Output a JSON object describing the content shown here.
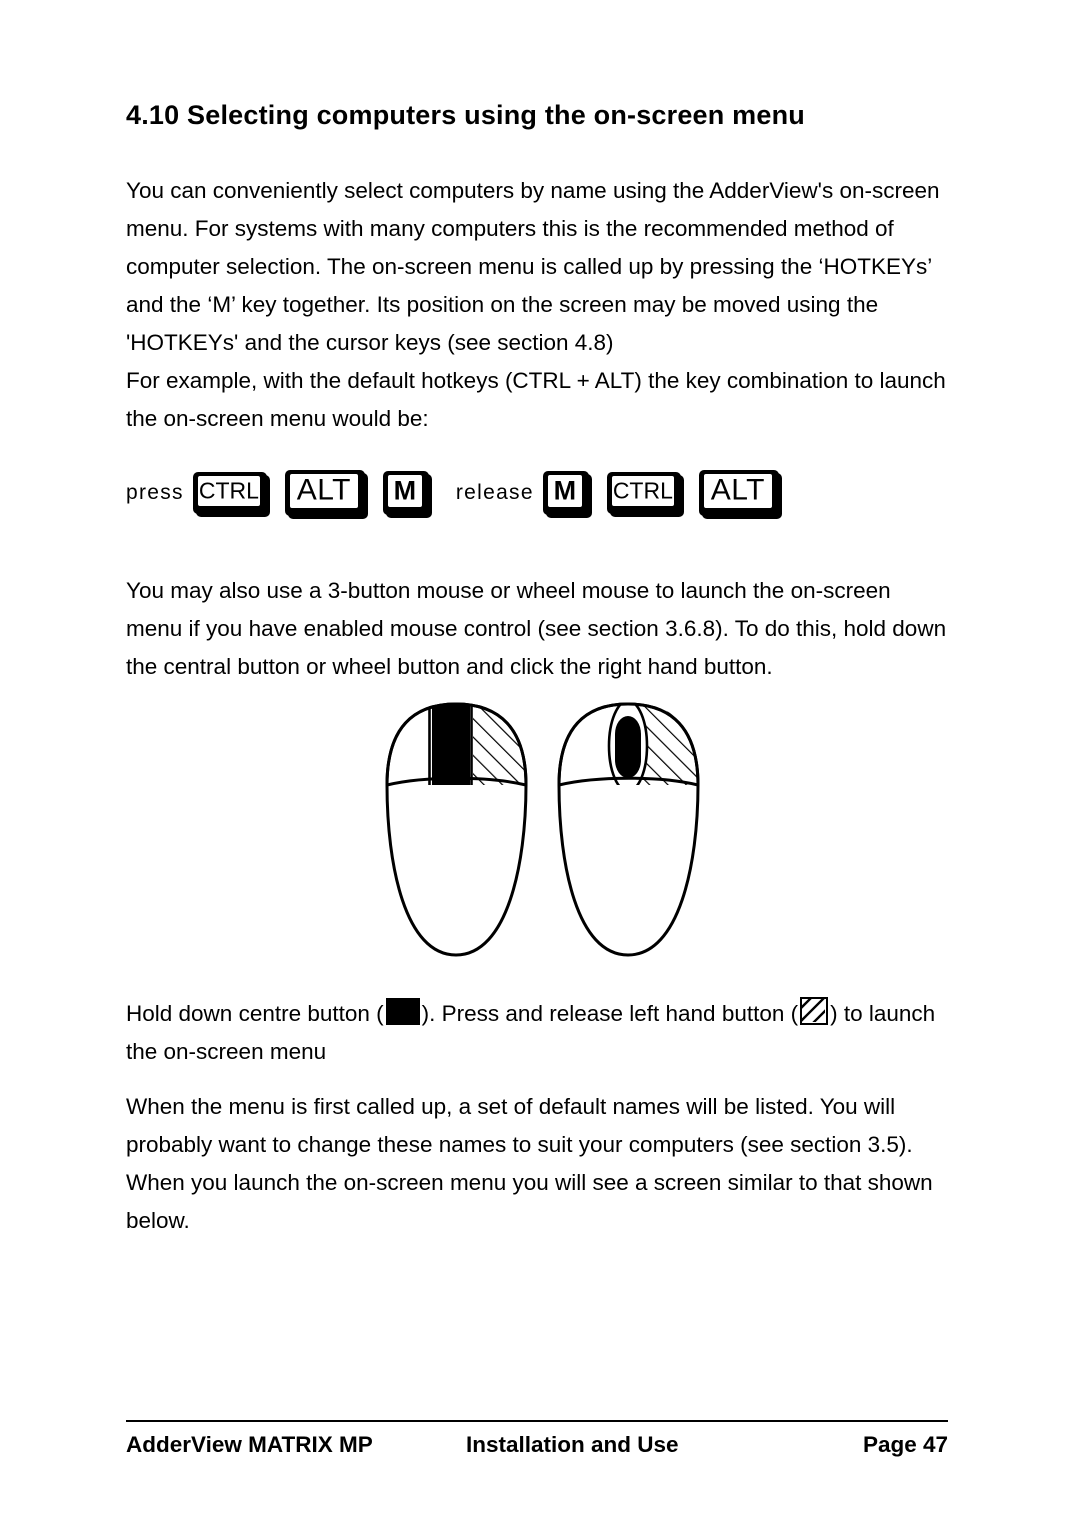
{
  "document": {
    "heading": "4.10 Selecting computers using the on-screen menu",
    "paragraphs": {
      "intro": "You can conveniently select computers by name using the AdderView's on-screen menu. For systems with many computers this is the recommended method of computer selection. The on-screen menu is called up by pressing the ‘HOTKEYs’ and the ‘M’ key together. Its position on the screen may be moved using the 'HOTKEYs' and the cursor keys (see section 4.8)",
      "example": "For example, with the default hotkeys (CTRL + ALT) the key combination to launch the on-screen menu would be:",
      "mouse": "You may also use a 3-button mouse or wheel mouse to launch the on-screen menu if you have enabled mouse control (see section 3.6.8). To do this, hold down the central button or wheel button and click the right hand button.",
      "names": "When the menu is first called up, a set of default names will be listed. You will probably want to change these names to suit your computers (see section 3.5). When you launch the on-screen menu you will see a screen similar to that shown below."
    },
    "key_sequence": {
      "press_label": "press",
      "press_keys": [
        "CTRL",
        "ALT",
        "M"
      ],
      "release_label": "release",
      "release_keys": [
        "M",
        "CTRL",
        "ALT"
      ]
    },
    "caption": {
      "part1": "Hold down centre button (",
      "part2": "). Press and release left hand button (",
      "part3": ") to launch the on-screen menu",
      "icon_centre_button": "solid-black-button-icon",
      "icon_left_button": "hatched-button-icon"
    },
    "figure": {
      "name": "mouse-buttons-diagram",
      "left_mouse": "three-button-mouse",
      "right_mouse": "wheel-mouse",
      "stroke_color": "#000000",
      "fill_color": "#ffffff"
    },
    "footer": {
      "left": "AdderView MATRIX MP",
      "center": "Installation and Use",
      "right": "Page 47"
    }
  }
}
